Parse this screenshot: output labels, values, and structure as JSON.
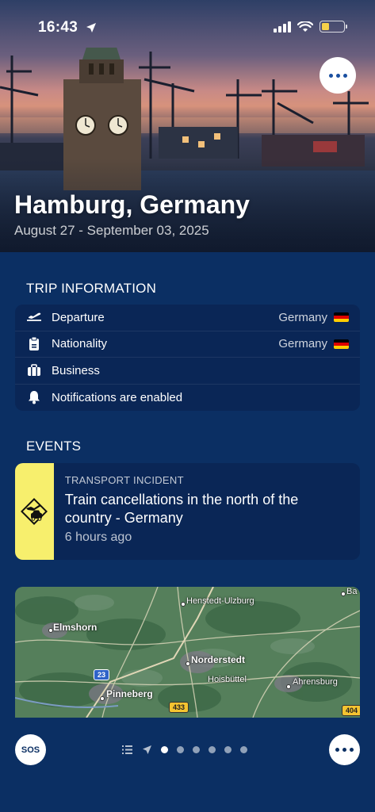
{
  "status_bar": {
    "time": "16:43"
  },
  "hero": {
    "title": "Hamburg, Germany",
    "dates": "August 27 - September 03, 2025",
    "more_icon": "more-horizontal-icon"
  },
  "trip_information": {
    "section_title": "TRIP INFORMATION",
    "rows": [
      {
        "icon": "airplane-departure-icon",
        "label": "Departure",
        "value": "Germany",
        "flag": "germany"
      },
      {
        "icon": "id-badge-icon",
        "label": "Nationality",
        "value": "Germany",
        "flag": "germany"
      },
      {
        "icon": "briefcase-icon",
        "label": "Business",
        "value": ""
      },
      {
        "icon": "bell-icon",
        "label": "Notifications are enabled",
        "value": ""
      }
    ]
  },
  "events": {
    "section_title": "EVENTS",
    "items": [
      {
        "category": "TRANSPORT INCIDENT",
        "title": "Train cancellations in the north of the country - Germany",
        "time": "6 hours ago",
        "icon": "transport-incident-icon",
        "accent_color": "#f7ef6d"
      }
    ]
  },
  "map": {
    "places": [
      {
        "name": "Elmshorn"
      },
      {
        "name": "Henstedt-Ulzburg"
      },
      {
        "name": "Norderstedt"
      },
      {
        "name": "Hoisbüttel"
      },
      {
        "name": "Ahrensburg"
      },
      {
        "name": "Pinneberg"
      },
      {
        "name": "Ba"
      }
    ],
    "road_shields": [
      "23",
      "433",
      "404"
    ]
  },
  "bottom_bar": {
    "sos_label": "SOS",
    "pager": {
      "page_count": 6,
      "active_index": 0
    }
  },
  "colors": {
    "background": "#0b2f63",
    "card": "#0a2656",
    "incident_accent": "#f7ef6d"
  }
}
